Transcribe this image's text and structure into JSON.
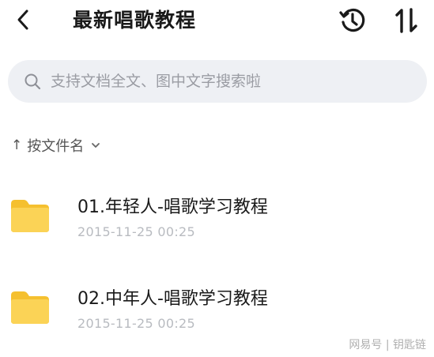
{
  "header": {
    "title": "最新唱歌教程",
    "back_icon": "chevron-left-icon",
    "history_icon": "history-icon",
    "sort_icon": "sort-arrows-icon"
  },
  "search": {
    "placeholder": "支持文档全文、图中文字搜索啦",
    "value": ""
  },
  "sort": {
    "arrow": "↑",
    "label": "按文件名"
  },
  "files": [
    {
      "name": "01.年轻人-唱歌学习教程",
      "date": "2015-11-25 00:25",
      "icon": "folder-icon"
    },
    {
      "name": "02.中年人-唱歌学习教程",
      "date": "2015-11-25 00:25",
      "icon": "folder-icon"
    }
  ],
  "watermark": "网易号 | 钥匙链",
  "colors": {
    "folder": "#f7c93c",
    "search_bg": "#eef0f4",
    "date_text": "#b8bbc0"
  }
}
